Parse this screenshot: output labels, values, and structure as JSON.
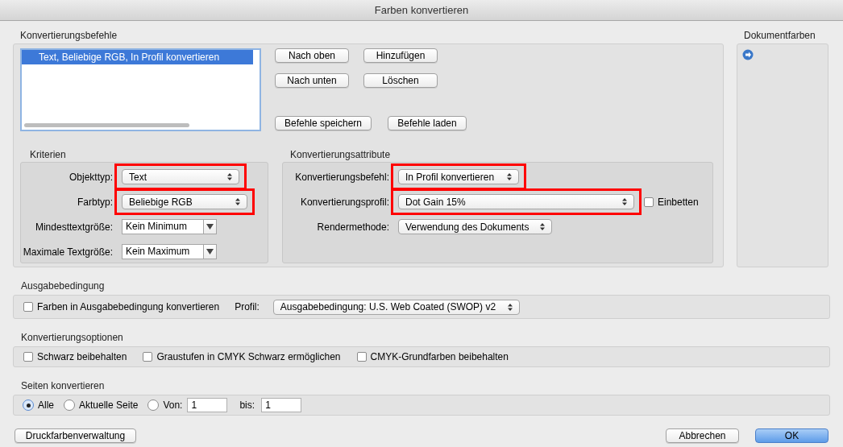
{
  "window": {
    "title": "Farben konvertieren"
  },
  "commands": {
    "label": "Konvertierungsbefehle",
    "items": [
      {
        "text": "Text, Beliebige RGB, In Profil konvertieren",
        "selected": true
      }
    ],
    "buttons": [
      "Nach oben",
      "Hinzufügen",
      "Nach unten",
      "Löschen"
    ],
    "file_buttons": [
      "Befehle speichern",
      "Befehle laden"
    ]
  },
  "criteria": {
    "label": "Kriterien",
    "fields": [
      {
        "label": "Objekttyp:",
        "value": "Text",
        "kind": "popup",
        "highlighted": true
      },
      {
        "label": "Farbtyp:",
        "value": "Beliebige RGB",
        "kind": "popup",
        "highlighted": true
      },
      {
        "label": "Mindesttextgröße:",
        "value": "Kein Minimum",
        "kind": "combo",
        "highlighted": false
      },
      {
        "label": "Maximale Textgröße:",
        "value": "Kein Maximum",
        "kind": "combo",
        "highlighted": false
      }
    ]
  },
  "attributes": {
    "label": "Konvertierungsattribute",
    "fields": [
      {
        "label": "Konvertierungsbefehl:",
        "value": "In Profil konvertieren",
        "highlighted": true
      },
      {
        "label": "Konvertierungsprofil:",
        "value": "Dot Gain 15%",
        "highlighted": true,
        "embed": {
          "label": "Einbetten",
          "checked": false
        }
      },
      {
        "label": "Rendermethode:",
        "value": "Verwendung des Dokuments",
        "highlighted": false
      }
    ]
  },
  "document_colors": {
    "label": "Dokumentfarben"
  },
  "output_condition": {
    "label": "Ausgabebedingung",
    "checkbox": {
      "label": "Farben in Ausgabebedingung konvertieren",
      "checked": false
    },
    "profile_label": "Profil:",
    "profile": "Ausgabebedingung: U.S. Web Coated (SWOP) v2"
  },
  "options": {
    "label": "Konvertierungsoptionen",
    "checkboxes": [
      {
        "label": "Schwarz beibehalten",
        "checked": false
      },
      {
        "label": "Graustufen in CMYK Schwarz ermöglichen",
        "checked": false
      },
      {
        "label": "CMYK-Grundfarben beibehalten",
        "checked": false
      }
    ]
  },
  "pages": {
    "label": "Seiten konvertieren",
    "radios": [
      {
        "label": "Alle",
        "selected": true
      },
      {
        "label": "Aktuelle Seite",
        "selected": false
      },
      {
        "label": "Von:",
        "selected": false
      }
    ],
    "from": "1",
    "to_label": "bis:",
    "to": "1"
  },
  "footer": {
    "left_button": "Druckfarbenverwaltung",
    "cancel": "Abbrechen",
    "ok": "OK"
  }
}
